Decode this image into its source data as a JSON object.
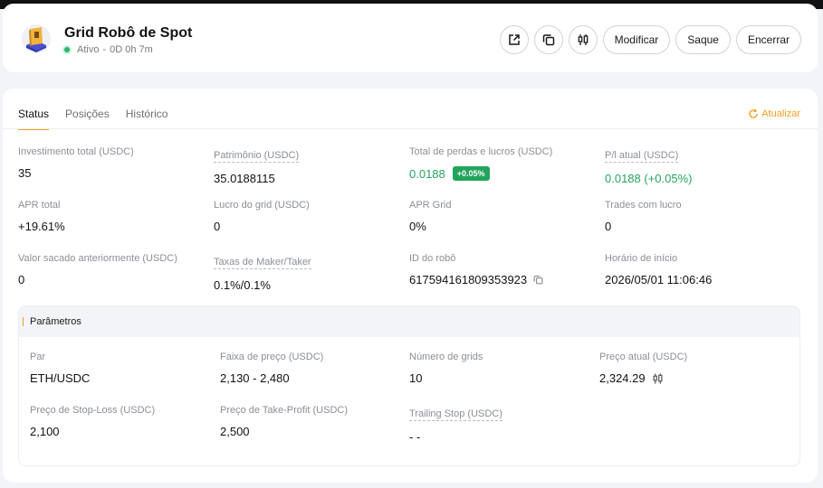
{
  "header": {
    "title": "Grid Robô de Spot",
    "status": "Ativo",
    "separator": "-",
    "duration": "0D 0h 7m",
    "buttons": {
      "modify": "Modificar",
      "withdraw": "Saque",
      "close": "Encerrar"
    }
  },
  "tabs": [
    {
      "label": "Status",
      "active": true
    },
    {
      "label": "Posições",
      "active": false
    },
    {
      "label": "Histórico",
      "active": false
    }
  ],
  "refresh_label": "Atualizar",
  "stats": [
    {
      "label": "Investimento total (USDC)",
      "value": "35"
    },
    {
      "label": "Patrimônio (USDC)",
      "value": "35.0188115"
    },
    {
      "label": "Total de perdas e lucros (USDC)",
      "value": "0.0188",
      "badge": "+0.05%"
    },
    {
      "label": "P/l atual (USDC)",
      "value": "0.0188 (+0.05%)"
    },
    {
      "label": "APR total",
      "value": "+19.61%"
    },
    {
      "label": "Lucro do grid (USDC)",
      "value": "0"
    },
    {
      "label": "APR Grid",
      "value": "0%"
    },
    {
      "label": "Trades com lucro",
      "value": "0"
    },
    {
      "label": "Valor sacado anteriormente (USDC)",
      "value": "0"
    },
    {
      "label": "Taxas de Maker/Taker",
      "value": "0.1%/0.1%"
    },
    {
      "label": "ID do robô",
      "value": "617594161809353923"
    },
    {
      "label": "Horário de início",
      "value": "2026/05/01 11:06:46"
    }
  ],
  "params": {
    "title": "Parâmetros",
    "items": [
      {
        "label": "Par",
        "value": "ETH/USDC"
      },
      {
        "label": "Faixa de preço (USDC)",
        "value": "2,130 - 2,480"
      },
      {
        "label": "Número de grids",
        "value": "10"
      },
      {
        "label": "Preço atual (USDC)",
        "value": "2,324.29"
      },
      {
        "label": "Preço de Stop-Loss (USDC)",
        "value": "2,100"
      },
      {
        "label": "Preço de Take-Profit (USDC)",
        "value": "2,500"
      },
      {
        "label": "Trailing Stop (USDC)",
        "value": "- -"
      }
    ]
  },
  "colors": {
    "accent": "#f0a020",
    "positive": "#2aa35f",
    "badge": "#22a45d",
    "active_dot": "#2bb673"
  }
}
